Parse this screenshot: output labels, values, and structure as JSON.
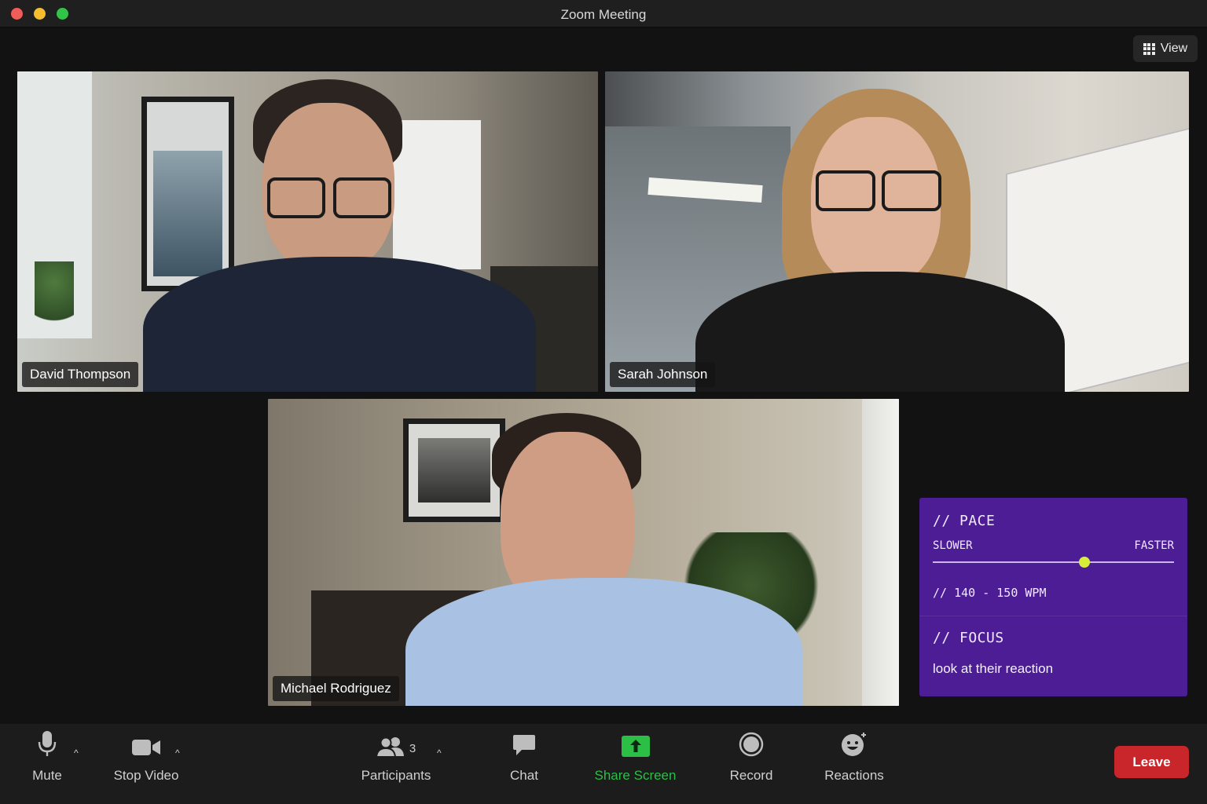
{
  "window": {
    "title": "Zoom Meeting"
  },
  "view_button": {
    "label": "View"
  },
  "participants": [
    {
      "name": "David Thompson"
    },
    {
      "name": "Sarah Johnson"
    },
    {
      "name": "Michael Rodriguez"
    }
  ],
  "pace_panel": {
    "pace_heading": "// PACE",
    "slower_label": "SLOWER",
    "faster_label": "FASTER",
    "slider_value": 0.63,
    "wpm_text": "// 140 - 150 WPM",
    "focus_heading": "// FOCUS",
    "focus_text": "look at their reaction",
    "accent_color": "#d6ee3a",
    "background_color": "#4c1d95"
  },
  "toolbar": {
    "mute_label": "Mute",
    "stop_video_label": "Stop Video",
    "participants_label": "Participants",
    "participants_count": "3",
    "chat_label": "Chat",
    "share_screen_label": "Share Screen",
    "record_label": "Record",
    "reactions_label": "Reactions",
    "leave_label": "Leave",
    "share_color": "#2bbf46",
    "leave_color": "#c8262a"
  }
}
